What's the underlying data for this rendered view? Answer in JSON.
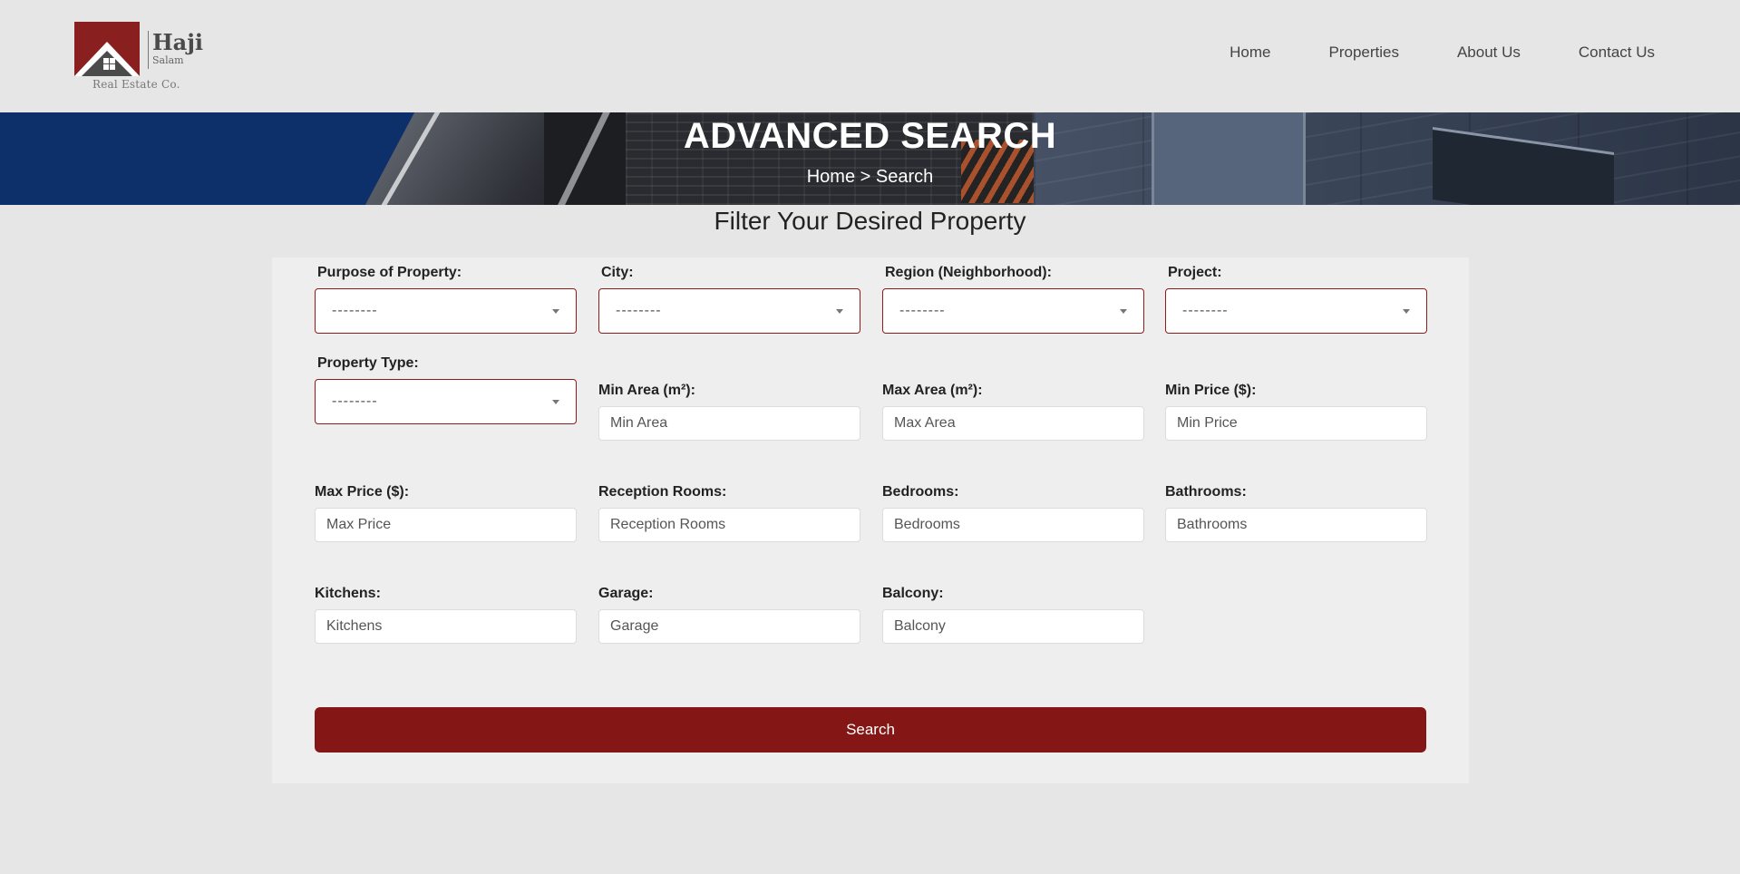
{
  "brand": {
    "name": "Haji",
    "sub": "Salam",
    "tagline": "Real Estate Co."
  },
  "nav": {
    "items": [
      "Home",
      "Properties",
      "About Us",
      "Contact Us"
    ]
  },
  "hero": {
    "title": "ADVANCED SEARCH",
    "breadcrumb": "Home > Search"
  },
  "form": {
    "title": "Filter Your Desired Property",
    "purpose": {
      "label": "Purpose of Property:",
      "value": "--------"
    },
    "city": {
      "label": "City:",
      "value": "--------"
    },
    "region": {
      "label": "Region (Neighborhood):",
      "value": "--------"
    },
    "project": {
      "label": "Project:",
      "value": "--------"
    },
    "property_type": {
      "label": "Property Type:",
      "value": "--------"
    },
    "min_area": {
      "label": "Min Area (m²):",
      "placeholder": "Min Area"
    },
    "max_area": {
      "label": "Max Area (m²):",
      "placeholder": "Max Area"
    },
    "min_price": {
      "label": "Min Price ($):",
      "placeholder": "Min Price"
    },
    "max_price": {
      "label": "Max Price ($):",
      "placeholder": "Max Price"
    },
    "reception_rooms": {
      "label": "Reception Rooms:",
      "placeholder": "Reception Rooms"
    },
    "bedrooms": {
      "label": "Bedrooms:",
      "placeholder": "Bedrooms"
    },
    "bathrooms": {
      "label": "Bathrooms:",
      "placeholder": "Bathrooms"
    },
    "kitchens": {
      "label": "Kitchens:",
      "placeholder": "Kitchens"
    },
    "garage": {
      "label": "Garage:",
      "placeholder": "Garage"
    },
    "balcony": {
      "label": "Balcony:",
      "placeholder": "Balcony"
    },
    "search_label": "Search"
  },
  "colors": {
    "accent": "#841616",
    "hero_blue": "#0d2f6a",
    "background": "#e6e6e6"
  }
}
